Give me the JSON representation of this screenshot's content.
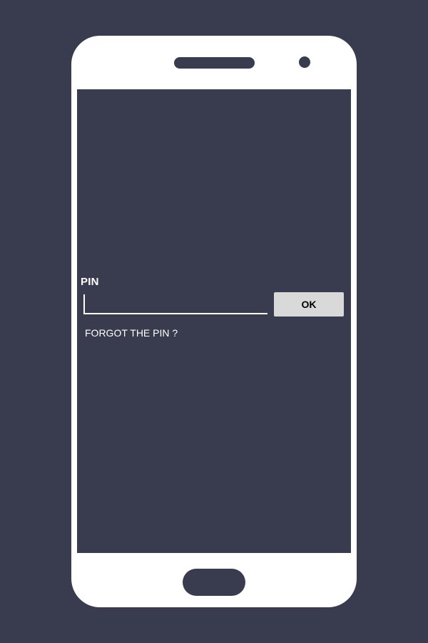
{
  "colors": {
    "background": "#393b4f",
    "device_frame": "#ffffff",
    "button": "#d9d9d9",
    "text": "#ffffff"
  },
  "screen": {
    "pin_label": "PIN",
    "pin_value": "",
    "ok_label": "OK",
    "forgot_label": "FORGOT THE PIN ?"
  }
}
